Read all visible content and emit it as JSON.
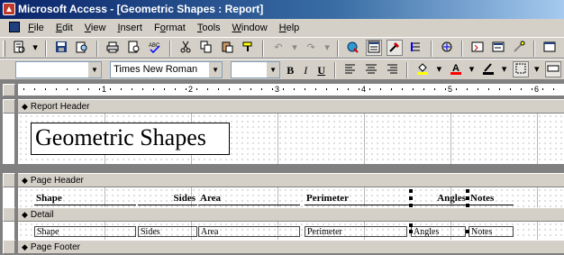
{
  "window": {
    "title": "Microsoft Access - [Geometric Shapes : Report]"
  },
  "menu": {
    "items": [
      {
        "label": "File",
        "accel": "F"
      },
      {
        "label": "Edit",
        "accel": "E"
      },
      {
        "label": "View",
        "accel": "V"
      },
      {
        "label": "Insert",
        "accel": "I"
      },
      {
        "label": "Format",
        "accel": "o"
      },
      {
        "label": "Tools",
        "accel": "T"
      },
      {
        "label": "Window",
        "accel": "W"
      },
      {
        "label": "Help",
        "accel": "H"
      }
    ]
  },
  "format_toolbar": {
    "object_value": "",
    "font_name": "Times New Roman",
    "font_size": "",
    "bold": "B",
    "italic": "I",
    "underline": "U"
  },
  "ruler": {
    "numbers": [
      "1",
      "2",
      "3",
      "4",
      "5",
      "6"
    ]
  },
  "report": {
    "sections": {
      "report_header": "Report Header",
      "page_header": "Page Header",
      "detail": "Detail",
      "page_footer": "Page Footer"
    },
    "title_label": "Geometric Shapes",
    "header_labels": {
      "shape": "Shape",
      "sides": "Sides",
      "area": "Area",
      "perimeter": "Perimeter",
      "angles": "Angles",
      "notes": "Notes"
    },
    "detail_fields": {
      "shape": "Shape",
      "sides": "Sides",
      "area": "Area",
      "perimeter": "Perimeter",
      "angles": "Angles",
      "notes": "Notes"
    }
  },
  "colors": {
    "title_bar_start": "#0a246a",
    "title_bar_end": "#a6caf0",
    "chrome": "#d4d0c8",
    "workspace": "#808080"
  }
}
